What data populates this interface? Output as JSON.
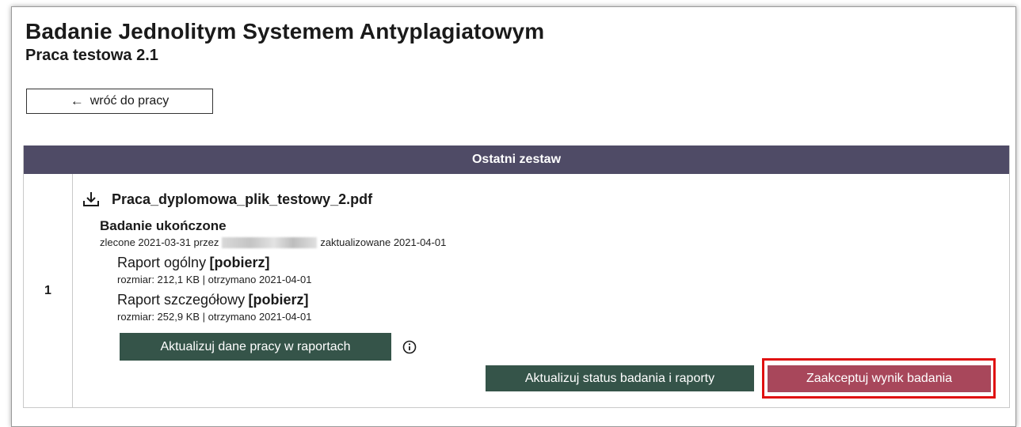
{
  "page": {
    "title": "Badanie Jednolitym Systemem Antyplagiatowym",
    "subtitle": "Praca testowa 2.1",
    "back_button": {
      "label": "wróć do pracy",
      "icon": "arrow-left-icon"
    }
  },
  "table": {
    "header": "Ostatni zestaw",
    "rows": [
      {
        "number": "1",
        "file": {
          "name": "Praca_dyplomowa_plik_testowy_2.pdf",
          "icon": "download-icon"
        },
        "status": "Badanie ukończone",
        "meta": {
          "ordered_prefix": "zlecone 2021-03-31 przez",
          "updated": "zaktualizowane 2021-04-01"
        },
        "reports": [
          {
            "label": "Raport ogólny",
            "link": "[pobierz]",
            "meta": "rozmiar: 212,1 KB | otrzymano 2021-04-01"
          },
          {
            "label": "Raport szczegółowy",
            "link": "[pobierz]",
            "meta": "rozmiar: 252,9 KB | otrzymano 2021-04-01"
          }
        ],
        "buttons": {
          "update_data": "Aktualizuj dane pracy w raportach",
          "update_status": "Aktualizuj status badania i raporty",
          "accept": "Zaakceptuj wynik badania"
        }
      }
    ]
  },
  "colors": {
    "header_bg": "#4f4b66",
    "button_dark": "#355449",
    "button_accept": "#a8475b",
    "highlight": "#e01010"
  }
}
